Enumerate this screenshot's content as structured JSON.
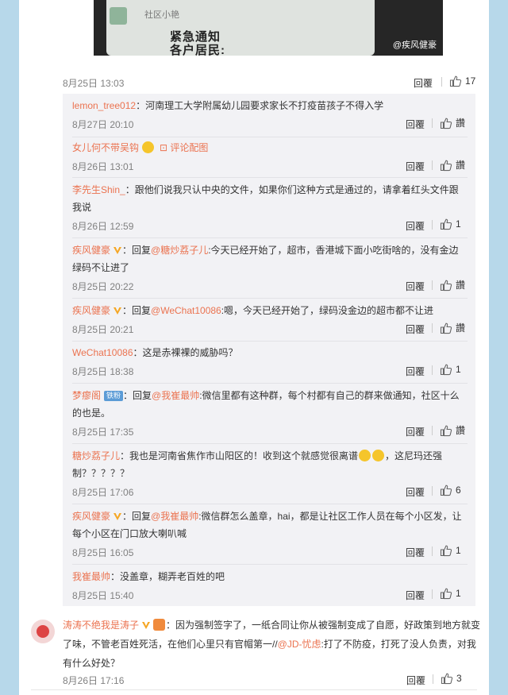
{
  "post_image": {
    "mini_name": "社区小艳",
    "line1": "紧急通知",
    "line2": "各户居民:",
    "watermark": "@疾风健豪"
  },
  "main_meta": {
    "time": "8月25日 13:03",
    "reply": "回覆",
    "likes": "17"
  },
  "comments": [
    {
      "name": "lemon_tree012",
      "segments": [
        "：河南理工大学附属幼儿园要求家长不打疫苗孩子不得入学"
      ],
      "time": "8月27日 20:10",
      "reply": "回覆",
      "likes": "讚"
    },
    {
      "name": "女儿何不带吴钩",
      "emoji": true,
      "img_link": "评论配图",
      "time": "8月26日 13:01",
      "reply": "回覆",
      "likes": "讚"
    },
    {
      "name": "李先生Shin_",
      "segments": [
        "：跟他们说我只认中央的文件，如果你们这种方式是通过的，请拿着红头文件跟我说"
      ],
      "time": "8月26日 12:59",
      "reply": "回覆",
      "likes": "1"
    },
    {
      "name": "疾风健豪",
      "verified": true,
      "prefix": "：回复",
      "at": "@糖炒荔子儿",
      "segments": [
        ":今天已经开始了，超市，香港城下面小吃街啥的，没有金边绿码不让进了"
      ],
      "time": "8月25日 20:22",
      "reply": "回覆",
      "likes": "讚"
    },
    {
      "name": "疾风健豪",
      "verified": true,
      "prefix": "：回复",
      "at": "@WeChat10086",
      "segments": [
        ":嗯，今天已经开始了，绿码没金边的超市都不让进"
      ],
      "time": "8月25日 20:21",
      "reply": "回覆",
      "likes": "讚"
    },
    {
      "name": "WeChat10086",
      "segments": [
        "：这是赤裸裸的威胁吗？"
      ],
      "time": "8月25日 18:38",
      "reply": "回覆",
      "likes": "1"
    },
    {
      "name": "梦瘳阁",
      "fan_badge": "铁粉",
      "prefix": "：回复",
      "at": "@我崔最帅",
      "segments": [
        ":微信里都有这种群，每个村都有自己的群来做通知，社区十么的也是。"
      ],
      "time": "8月25日 17:35",
      "reply": "回覆",
      "likes": "讚"
    },
    {
      "name": "糖炒荔子儿",
      "segments": [
        "：我也是河南省焦作市山阳区的！收到这个就感觉很离谱"
      ],
      "emoji_after": true,
      "segments2": [
        "，这尼玛还强制？？？？？"
      ],
      "time": "8月25日 17:06",
      "reply": "回覆",
      "likes": "6"
    },
    {
      "name": "疾风健豪",
      "verified": true,
      "prefix": "：回复",
      "at": "@我崔最帅",
      "segments": [
        ":微信群怎么盖章，hai，都是让社区工作人员在每个小区发，让每个小区在门口放大喇叭喊"
      ],
      "time": "8月25日 16:05",
      "reply": "回覆",
      "likes": "1"
    },
    {
      "name": "我崔最帅",
      "segments": [
        "：没盖章，糊弄老百姓的吧"
      ],
      "time": "8月25日 15:40",
      "reply": "回覆",
      "likes": "1"
    }
  ],
  "top_comment": {
    "name": "涛涛不绝我是涛子",
    "text1": "：因为强制签字了，一纸合同让你从被强制变成了自愿，好政策到地方就变了味，不管老百姓死活，在他们心里只有官帽第一//",
    "at": "@JD-忧虑",
    "text2": ":打了不防疫，打死了没人负责，对我有什么好处？",
    "time": "8月26日 17:16",
    "reply": "回覆",
    "likes": "3"
  },
  "colors": {
    "name": "#eb7350",
    "sub_bg": "#f2f2f5",
    "page_bg": "#b7d8ea"
  }
}
